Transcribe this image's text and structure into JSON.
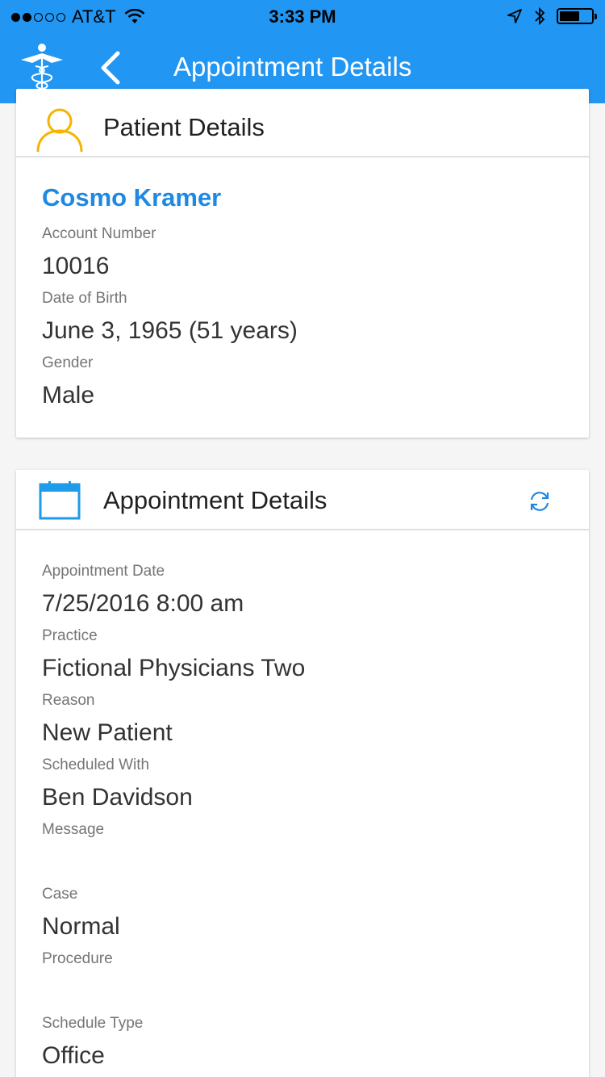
{
  "status_bar": {
    "carrier": "AT&T",
    "time": "3:33 PM",
    "signal_bars_filled": 2,
    "signal_bars_total": 5
  },
  "nav": {
    "title": "Appointment Details",
    "logo_icon": "caduceus-icon",
    "back_icon": "chevron-left-icon"
  },
  "patient_card": {
    "header": "Patient Details",
    "icon": "person-icon",
    "name": "Cosmo Kramer",
    "fields": [
      {
        "label": "Account Number",
        "value": "10016"
      },
      {
        "label": "Date of Birth",
        "value": "June 3, 1965 (51 years)"
      },
      {
        "label": "Gender",
        "value": "Male"
      }
    ]
  },
  "appointment_card": {
    "header": "Appointment Details",
    "icon": "calendar-icon",
    "action_icon": "refresh-icon",
    "fields": [
      {
        "label": "Appointment Date",
        "value": "7/25/2016 8:00 am"
      },
      {
        "label": "Practice",
        "value": "Fictional Physicians Two"
      },
      {
        "label": "Reason",
        "value": "New Patient"
      },
      {
        "label": "Scheduled With",
        "value": "Ben Davidson"
      },
      {
        "label": "Message",
        "value": ""
      },
      {
        "label": "Case",
        "value": "Normal"
      },
      {
        "label": "Procedure",
        "value": ""
      },
      {
        "label": "Schedule Type",
        "value": "Office"
      }
    ]
  },
  "colors": {
    "accent": "#2196f3",
    "name_blue": "#1e88e5",
    "person_icon": "#f5b400",
    "calendar_icon": "#1e9be9"
  }
}
